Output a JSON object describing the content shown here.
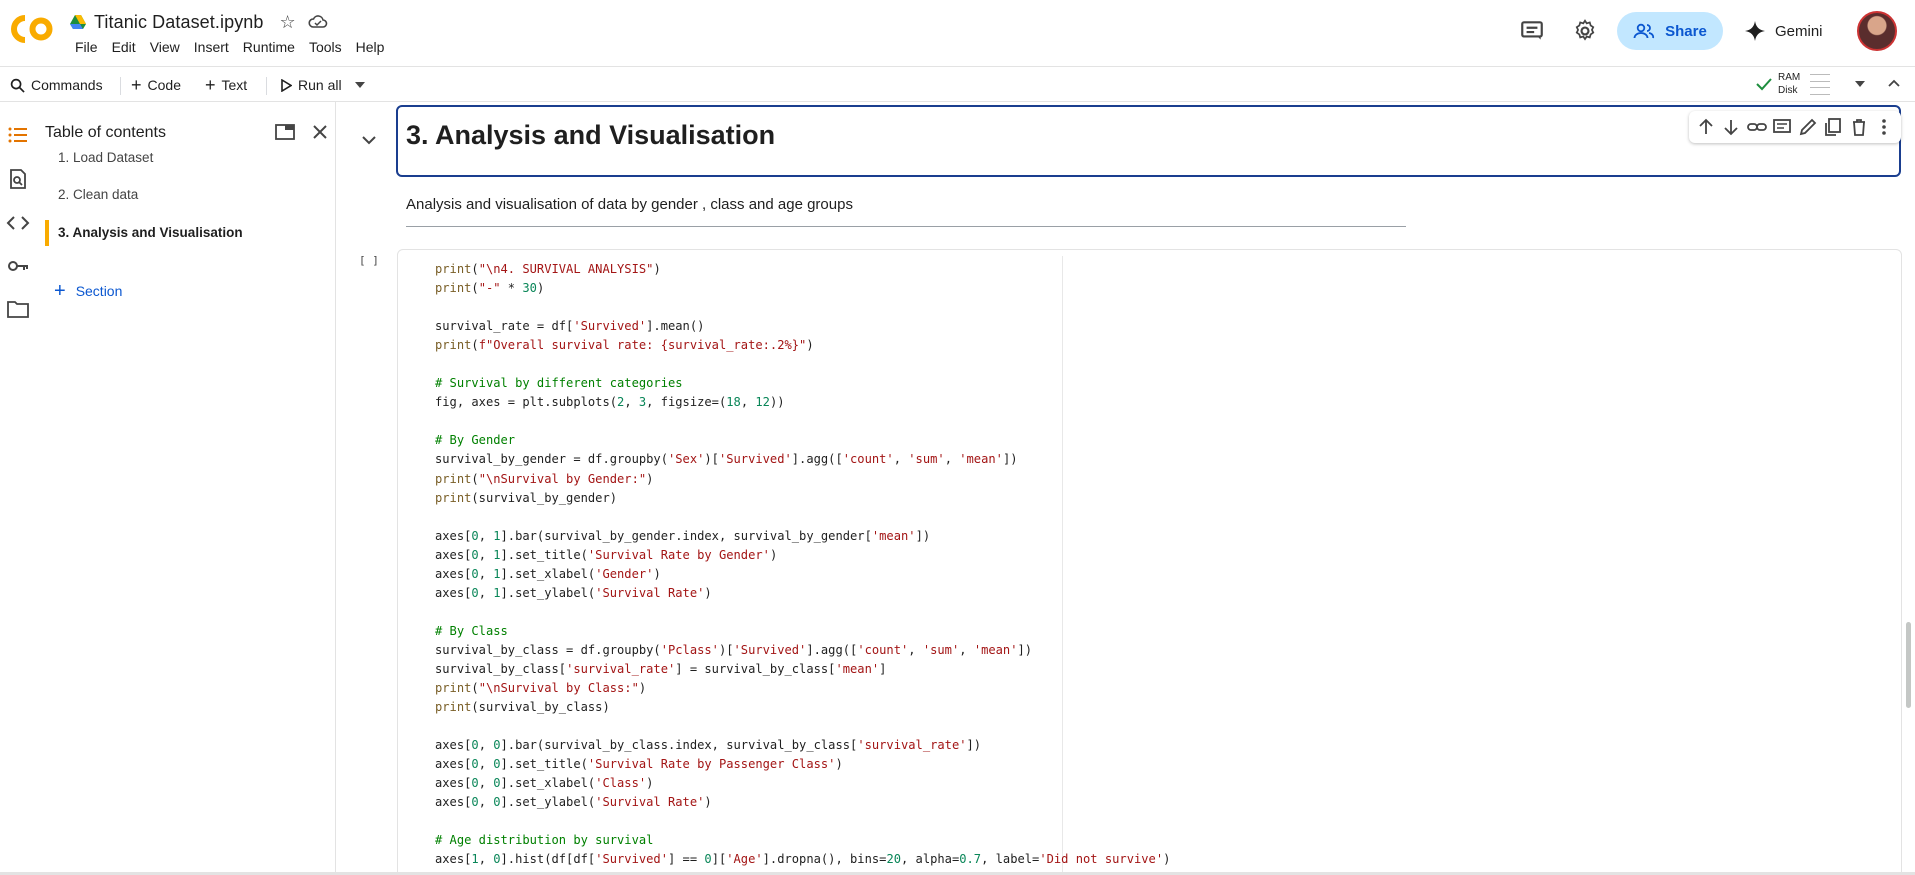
{
  "app": {
    "title": "Titanic Dataset.ipynb",
    "brand_colors": {
      "logo_orange": "#f9ab00",
      "share_bg": "#c2e7ff",
      "link_blue": "#0b57d0",
      "focus_border": "#1a3e8f"
    }
  },
  "menu": [
    "File",
    "Edit",
    "View",
    "Insert",
    "Runtime",
    "Tools",
    "Help"
  ],
  "header_right": {
    "share_label": "Share",
    "gemini_label": "Gemini"
  },
  "toolbar": {
    "commands_label": "Commands",
    "code_label": "Code",
    "text_label": "Text",
    "run_all_label": "Run all",
    "ram_label": "RAM",
    "disk_label": "Disk"
  },
  "toc": {
    "title": "Table of contents",
    "items": [
      "1. Load Dataset",
      "2. Clean data",
      "3. Analysis and Visualisation"
    ],
    "active_index": 2,
    "add_section_label": "Section"
  },
  "notebook": {
    "heading": "3. Analysis and Visualisation",
    "description": "Analysis and visualisation of data by gender , class and age groups",
    "run_indicator": "[ ]",
    "code_lines": [
      "print(\"\\n4. SURVIVAL ANALYSIS\")",
      "print(\"-\" * 30)",
      "",
      "survival_rate = df['Survived'].mean()",
      "print(f\"Overall survival rate: {survival_rate:.2%}\")",
      "",
      "# Survival by different categories",
      "fig, axes = plt.subplots(2, 3, figsize=(18, 12))",
      "",
      "# By Gender",
      "survival_by_gender = df.groupby('Sex')['Survived'].agg(['count', 'sum', 'mean'])",
      "print(\"\\nSurvival by Gender:\")",
      "print(survival_by_gender)",
      "",
      "axes[0, 1].bar(survival_by_gender.index, survival_by_gender['mean'])",
      "axes[0, 1].set_title('Survival Rate by Gender')",
      "axes[0, 1].set_xlabel('Gender')",
      "axes[0, 1].set_ylabel('Survival Rate')",
      "",
      "# By Class",
      "survival_by_class = df.groupby('Pclass')['Survived'].agg(['count', 'sum', 'mean'])",
      "survival_by_class['survival_rate'] = survival_by_class['mean']",
      "print(\"\\nSurvival by Class:\")",
      "print(survival_by_class)",
      "",
      "axes[0, 0].bar(survival_by_class.index, survival_by_class['survival_rate'])",
      "axes[0, 0].set_title('Survival Rate by Passenger Class')",
      "axes[0, 0].set_xlabel('Class')",
      "axes[0, 0].set_ylabel('Survival Rate')",
      "",
      "# Age distribution by survival",
      "axes[1, 0].hist(df[df['Survived'] == 0]['Age'].dropna(), bins=20, alpha=0.7, label='Did not survive')"
    ]
  }
}
